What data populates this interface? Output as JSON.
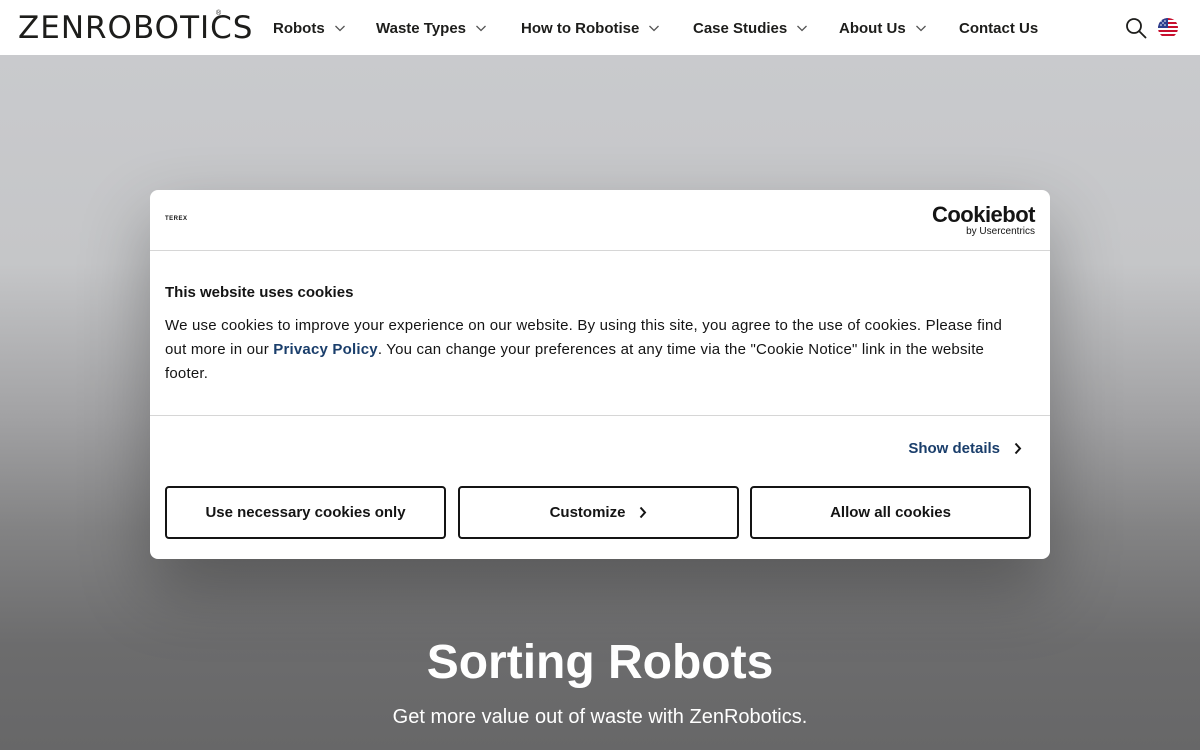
{
  "header": {
    "logo": "ZENROBOTICS",
    "logo_mark": "®",
    "nav": [
      {
        "label": "Robots"
      },
      {
        "label": "Waste Types"
      },
      {
        "label": "How to Robotise"
      },
      {
        "label": "Case Studies"
      },
      {
        "label": "About Us"
      },
      {
        "label": "Contact Us"
      }
    ],
    "icons": {
      "search": "search-icon",
      "language": "us-flag-icon"
    }
  },
  "hero": {
    "title": "Sorting Robots",
    "subtitle": "Get more value out of waste with ZenRobotics."
  },
  "cookie_dialog": {
    "owner_logo": "TEREX",
    "brand": "Cookiebot",
    "brand_by": "by Usercentrics",
    "title": "This website uses cookies",
    "body_before": "We use cookies to improve your experience on our website. By using this site, you agree to the use of cookies. Please find out more in our ",
    "body_link": "Privacy Policy",
    "body_after": ". You can change your preferences at any time via the \"Cookie Notice\" link in the website footer.",
    "show_details": "Show details",
    "buttons": {
      "necessary": "Use necessary cookies only",
      "customize": "Customize",
      "allow_all": "Allow all cookies"
    }
  },
  "colors": {
    "text": "#141414",
    "link": "#1a3e6b",
    "header_bg": "#ffffff"
  }
}
